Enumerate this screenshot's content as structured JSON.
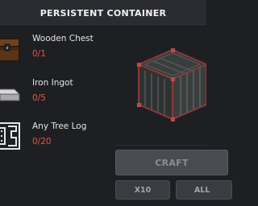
{
  "header": {
    "title": "PERSISTENT CONTAINER"
  },
  "colors": {
    "missing": "#e0574b",
    "panel": "#2b2c31",
    "button": "#4a4b51"
  },
  "ingredients": [
    {
      "name": "Wooden Chest",
      "have": "0/1",
      "icon": "chest-icon"
    },
    {
      "name": "Iron Ingot",
      "have": "0/5",
      "icon": "iron-ingot-icon"
    },
    {
      "name": "Any Tree Log",
      "have": "0/20",
      "icon": "tree-log-icon"
    }
  ],
  "preview": {
    "icon": "persistent-container-crate-icon"
  },
  "actions": {
    "craft_label": "CRAFT",
    "x10_label": "X10",
    "all_label": "ALL"
  }
}
